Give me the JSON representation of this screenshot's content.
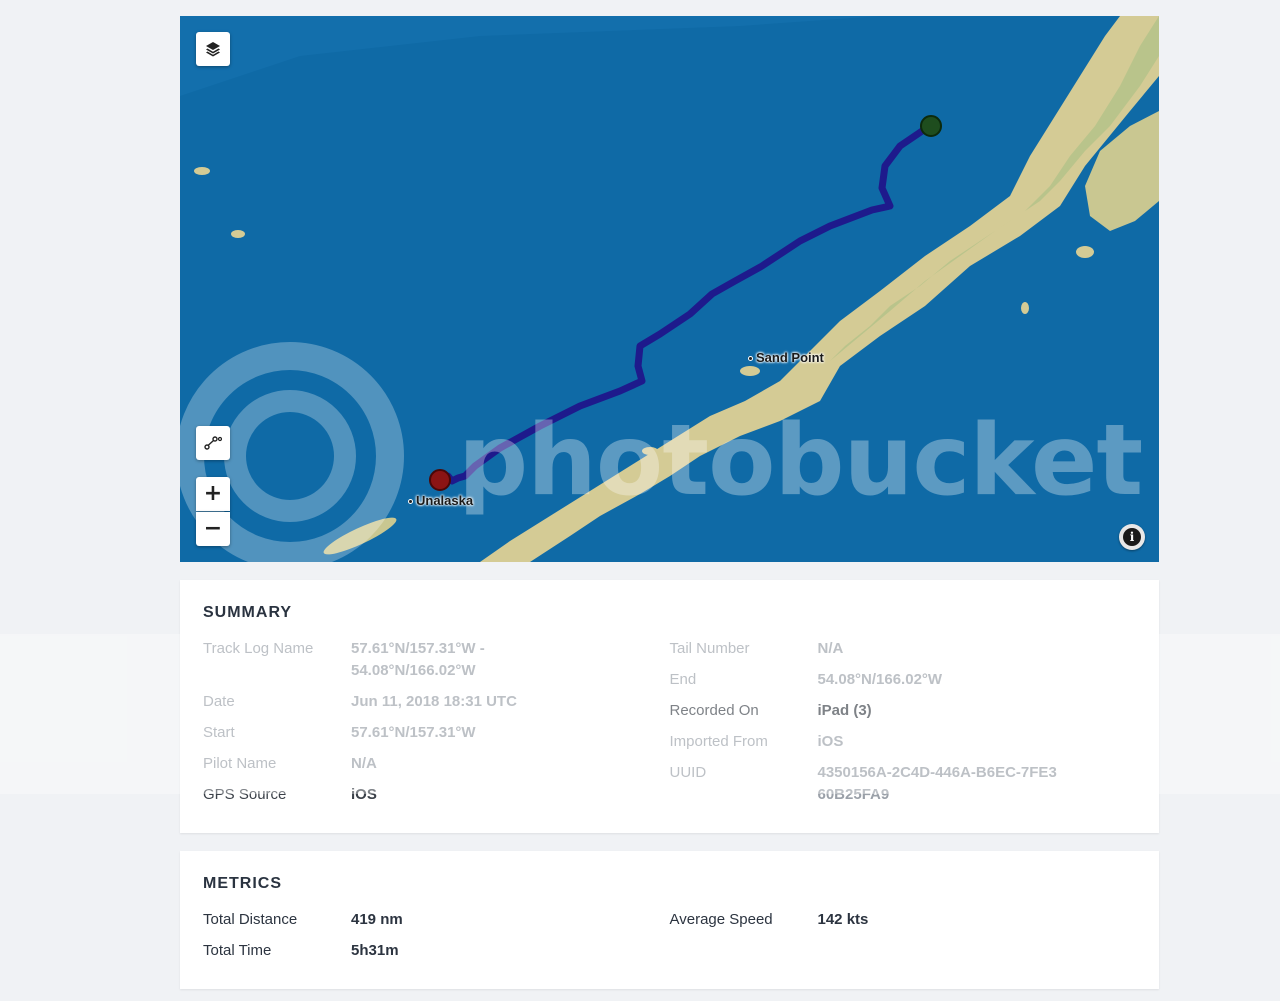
{
  "map": {
    "places": [
      {
        "name": "Sand Point"
      },
      {
        "name": "Unalaska"
      }
    ],
    "controls": {
      "layers_icon": "layers-icon",
      "route_icon": "route-icon",
      "zoom_in": "+",
      "zoom_out": "−",
      "info": "i"
    },
    "colors": {
      "water": "#0f6aa6",
      "land": "#d8d2a0",
      "track": "#1e1a8c",
      "start_marker": "#1e4d1e",
      "end_marker": "#8b1414"
    },
    "watermark": "photobucket"
  },
  "summary": {
    "title": "SUMMARY",
    "left": [
      {
        "label": "Track Log Name",
        "value": "57.61°N/157.31°W - 54.08°N/166.02°W"
      },
      {
        "label": "Date",
        "value": "Jun 11, 2018 18:31 UTC"
      },
      {
        "label": "Start",
        "value": "57.61°N/157.31°W"
      },
      {
        "label": "Pilot Name",
        "value": "N/A"
      },
      {
        "label": "GPS Source",
        "value": "iOS"
      }
    ],
    "right": [
      {
        "label": "Tail Number",
        "value": "N/A"
      },
      {
        "label": "End",
        "value": "54.08°N/166.02°W"
      },
      {
        "label": "Recorded On",
        "value": "iPad (3)"
      },
      {
        "label": "Imported From",
        "value": "iOS"
      },
      {
        "label": "UUID",
        "value": "4350156A-2C4D-446A-B6EC-7FE360B25FA9"
      }
    ]
  },
  "metrics": {
    "title": "METRICS",
    "left": [
      {
        "label": "Total Distance",
        "value": "419 nm"
      },
      {
        "label": "Total Time",
        "value": "5h31m"
      }
    ],
    "right": [
      {
        "label": "Average Speed",
        "value": "142 kts"
      }
    ]
  }
}
